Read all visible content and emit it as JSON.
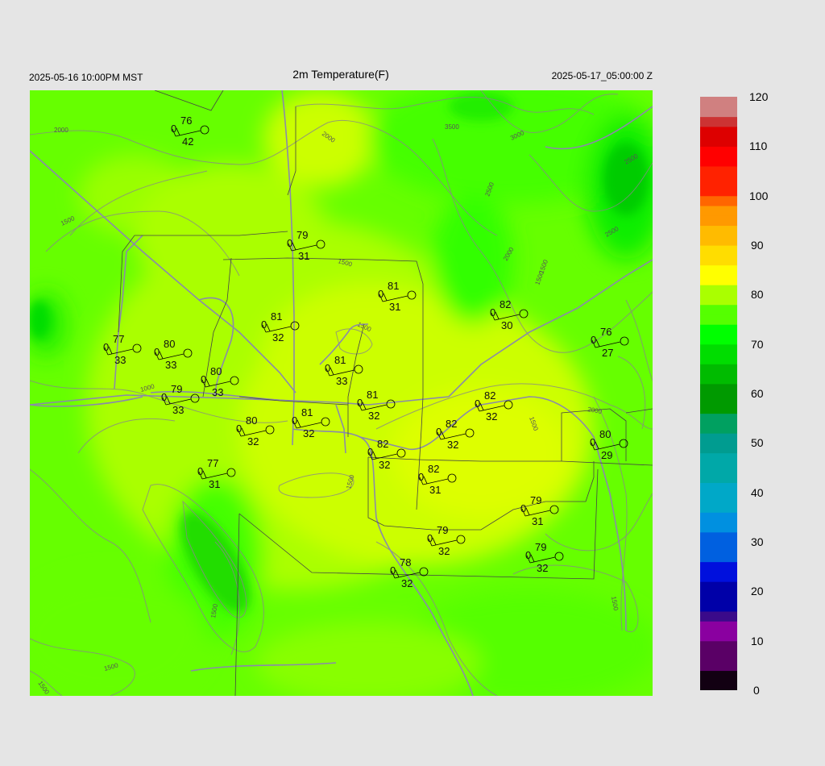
{
  "header": {
    "local_time": "2025-05-16 10:00PM MST",
    "title": "2m Temperature(F)",
    "utc_time": "2025-05-17_05:00:00 Z"
  },
  "colorbar": {
    "min": 0,
    "max": 120,
    "ticks": [
      "0",
      "10",
      "20",
      "30",
      "40",
      "50",
      "60",
      "70",
      "80",
      "90",
      "100",
      "110",
      "120"
    ],
    "colors": [
      {
        "v": 0,
        "c": "#120012"
      },
      {
        "v": 5,
        "c": "#5a0066"
      },
      {
        "v": 10,
        "c": "#8a00a0"
      },
      {
        "v": 14,
        "c": "#3a0a8a"
      },
      {
        "v": 17,
        "c": "#0000a8"
      },
      {
        "v": 22,
        "c": "#0010dd"
      },
      {
        "v": 27,
        "c": "#0060e0"
      },
      {
        "v": 32,
        "c": "#0090e0"
      },
      {
        "v": 37,
        "c": "#00a8c8"
      },
      {
        "v": 43,
        "c": "#00a8a8"
      },
      {
        "v": 48,
        "c": "#009c90"
      },
      {
        "v": 53,
        "c": "#00a060"
      },
      {
        "v": 57,
        "c": "#009a00"
      },
      {
        "v": 62,
        "c": "#00bb00"
      },
      {
        "v": 66,
        "c": "#00dd00"
      },
      {
        "v": 70,
        "c": "#00ff00"
      },
      {
        "v": 74,
        "c": "#55ff00"
      },
      {
        "v": 78,
        "c": "#aaff00"
      },
      {
        "v": 82,
        "c": "#ffff00"
      },
      {
        "v": 86,
        "c": "#ffdd00"
      },
      {
        "v": 90,
        "c": "#ffbb00"
      },
      {
        "v": 94,
        "c": "#ff9900"
      },
      {
        "v": 98,
        "c": "#ff6600"
      },
      {
        "v": 101,
        "c": "#ff2200"
      },
      {
        "v": 106,
        "c": "#ff0000"
      },
      {
        "v": 111,
        "c": "#dd0000"
      },
      {
        "v": 114,
        "c": "#cc3333"
      },
      {
        "v": 117,
        "c": "#d08080"
      },
      {
        "v": 120,
        "c": "#d0c8c8"
      }
    ]
  },
  "contour_labels": [
    "2000",
    "2000",
    "3500",
    "3000",
    "2500",
    "2500",
    "2500",
    "2000",
    "1500",
    "1500",
    "1500",
    "1500",
    "1500",
    "1000",
    "1500",
    "1500",
    "1500",
    "2000",
    "1500",
    "1500",
    "1500",
    "1500"
  ],
  "stations": [
    {
      "t": "76",
      "td": "42",
      "g": "0"
    },
    {
      "t": "79",
      "td": "31",
      "g": "0"
    },
    {
      "t": "81",
      "td": "31",
      "g": "0"
    },
    {
      "t": "82",
      "td": "30",
      "g": "0"
    },
    {
      "t": "76",
      "td": "27",
      "g": "0"
    },
    {
      "t": "77",
      "td": "33",
      "g": "0"
    },
    {
      "t": "80",
      "td": "33",
      "g": "0"
    },
    {
      "t": "81",
      "td": "32",
      "g": "0"
    },
    {
      "t": "81",
      "td": "33",
      "g": "0"
    },
    {
      "t": "80",
      "td": "33",
      "g": "0"
    },
    {
      "t": "79",
      "td": "33",
      "g": "0"
    },
    {
      "t": "81",
      "td": "32",
      "g": "0"
    },
    {
      "t": "82",
      "td": "32",
      "g": "0"
    },
    {
      "t": "80",
      "td": "32",
      "g": "0"
    },
    {
      "t": "81",
      "td": "32",
      "g": "0"
    },
    {
      "t": "82",
      "td": "32",
      "g": "0"
    },
    {
      "t": "80",
      "td": "29",
      "g": "0"
    },
    {
      "t": "82",
      "td": "32",
      "g": "0"
    },
    {
      "t": "77",
      "td": "31",
      "g": "0"
    },
    {
      "t": "82",
      "td": "31",
      "g": "0"
    },
    {
      "t": "79",
      "td": "31",
      "g": "0"
    },
    {
      "t": "79",
      "td": "32",
      "g": "0"
    },
    {
      "t": "79",
      "td": "32",
      "g": "0"
    },
    {
      "t": "78",
      "td": "32",
      "g": "0"
    }
  ]
}
